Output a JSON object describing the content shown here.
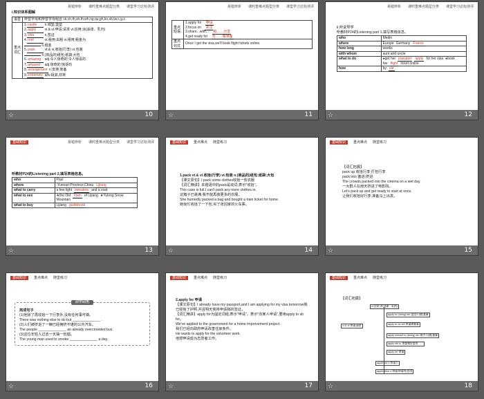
{
  "header": {
    "tab1": "基础知识",
    "tab2": "重点难点",
    "tab3": "随堂练习",
    "r1": "易错辨析",
    "r2": "课时重难点题型分类",
    "r3": "课堂学习达标测评"
  },
  "slides": [
    {
      "num": "10",
      "title": "Ⅰ.知识体系图解",
      "row1_head": "语音",
      "row1_text": "辨音字母和辨音字母组合 ck,ch,th,sh,th,wh,ng,qu,gh,kn,sb,tw,c,g,x",
      "row2_head": "重点词汇",
      "vocab": [
        {
          "n": "1.",
          "w": "castle",
          "d": "n.城堡;堡垒"
        },
        {
          "n": "2.",
          "w": "apply",
          "d": "vi.& vt.申请;请求  vt.应用;涂(油漆、乳剂)"
        },
        {
          "n": "3.",
          "w": "visa",
          "d": "n.签证"
        },
        {
          "n": "4.",
          "w": "rent",
          "d": "vt.租用;出租  vi.租用;租金为"
        },
        {
          "n": "",
          "w": "",
          "d": "n.租金"
        },
        {
          "n": "5.",
          "w": "pack",
          "d": "vt.& vi.收拾(行李)  vt.包装"
        },
        {
          "n": "",
          "w": "",
          "d": "n.(商品的)纸包;纸袋;大包"
        },
        {
          "n": "6.",
          "w": "amazing",
          "d": "adj.令人惊奇的;令人惊喜的"
        },
        {
          "n": "7.",
          "w": "amazed",
          "d": "adj.惊奇的;惊讶的"
        },
        {
          "n": "8.",
          "w": "arrangement",
          "d": "n.安排;筹备"
        },
        {
          "n": "9.",
          "w": "extremely",
          "d": "adv.极其,非常"
        }
      ]
    },
    {
      "num": "11",
      "row1_head": "重点短语",
      "phrases": [
        {
          "t": "1.apply for",
          "a": "申请"
        },
        {
          "t": "2.focus on",
          "a": "关注"
        },
        {
          "t": "3.share...with...",
          "a": "和……分享"
        },
        {
          "t": "4.get ready for",
          "a": "为……做准备"
        }
      ],
      "row2_head": "重点句式",
      "sentence": "Once I get the visa,we'll book flight tickets online."
    },
    {
      "num": "12",
      "title": "Ⅱ.听说导学",
      "intro": "听教材P24的Listening part 1,填写表格信息。",
      "rows": [
        {
          "k": "who",
          "v": "Medin"
        },
        {
          "k": "where",
          "v": "Europe",
          "v2": "Germany",
          "v3": "France"
        },
        {
          "k": "how long",
          "v": "weeks"
        },
        {
          "k": "with whom",
          "v": "aunt and uncle"
        },
        {
          "k": "what to do",
          "v": "●get her",
          "a": "passport",
          "v4": "apply",
          "v5": "for her visa",
          "v6": "●book her",
          "a2": "flight",
          "v7": "ticket online"
        },
        {
          "k": "how",
          "v": "by",
          "a": "car"
        }
      ]
    },
    {
      "num": "13",
      "intro": "听教材P24的Listening part 2,填写表格信息。",
      "rows": [
        {
          "k": "who",
          "v": "Paul"
        },
        {
          "k": "where",
          "a": "Lijiang",
          "v": ",Yunnan Province,China"
        },
        {
          "k": "what to carry",
          "v": "a few light",
          "a": "sweaters",
          "v2": "and a coat"
        },
        {
          "k": "what to see",
          "v": "★the Old",
          "a": "Town",
          "v2": "of Lijiang",
          "v3": "★Yulong Snow Mountain"
        },
        {
          "k": "what to buy",
          "v": "Lijiang",
          "a": "guidebook"
        }
      ]
    },
    {
      "num": "14",
      "title": "1.pack vt.& vi.收拾(行李)  vt.包装  n.(商品的)纸包;纸袋;大包",
      "lines": [
        "【课文原句】I pack some clothes收拾一些衣服",
        "【词汇精讲】本题语中的pack是动词,表示\"收拾\"。",
        "This case is full.I can't pack any more clothes in.",
        "这箱子已装满,我不能再装更多的衣服。",
        "She hurriedly packed a bag and bought a train ticket for home.",
        "她匆忙收拾了一下包,买了张回家的火车票。"
      ]
    },
    {
      "num": "15",
      "title": "【词汇拓展】",
      "lines": [
        "pack up  收拾行李;打包行李",
        "pack into  塞进;挤进",
        "The crowds packed into the cinema on a wet day.",
        "一大群人在雨天挤进了电影院。",
        "Let's pack up and get ready to start at once.",
        "让我们收拾好行李,准备马上出发。"
      ]
    },
    {
      "num": "16",
      "pill": "即学即用",
      "heading": "完成句子",
      "lines": [
        "(1)他除了再收拾一下行李外,没有任何事可做。",
        "There was nothing else to do but ______________ .",
        "(2)人们被挤进了一辆已经拥挤不堪的公共汽车。",
        "The people ______________ an already overcrowded bus.",
        "(3)这位年轻人过去一天抽一包烟。",
        "The young man used to smoke ______________ a day."
      ]
    },
    {
      "num": "17",
      "title": "2.apply for 申请",
      "lines": [
        "【课文原句】I already have my passport,and I am applying for my visa tomorrow我已经有了护照,并且明天我将申请我的签证。",
        "【词汇精讲】apply for为固定词组,表示\"申请\"。表示\"向某人申请\",要用apply to sb for。",
        "We've applied to the government for a home improvement project.",
        "我们已经向政府申请改善住房条件。",
        "He wants to apply for the volunteer work.",
        "他想申请成为志愿者工作。"
      ]
    },
    {
      "num": "18",
      "title": "【词汇拓展】",
      "boxes": [
        "vt.应用;涂(油漆、乳剂)",
        "apply to (doing) sth 适用于(做)某事",
        "vi.& vt.申请;请求",
        "apply to do sth 申请做某事",
        "apply oneself to (doing) sth 致力于(做)某事",
        "apply sth to 把某物应用到……",
        "apply for 申请",
        "applicant n.申请人",
        "application n.申请;申请书;应用"
      ]
    }
  ]
}
